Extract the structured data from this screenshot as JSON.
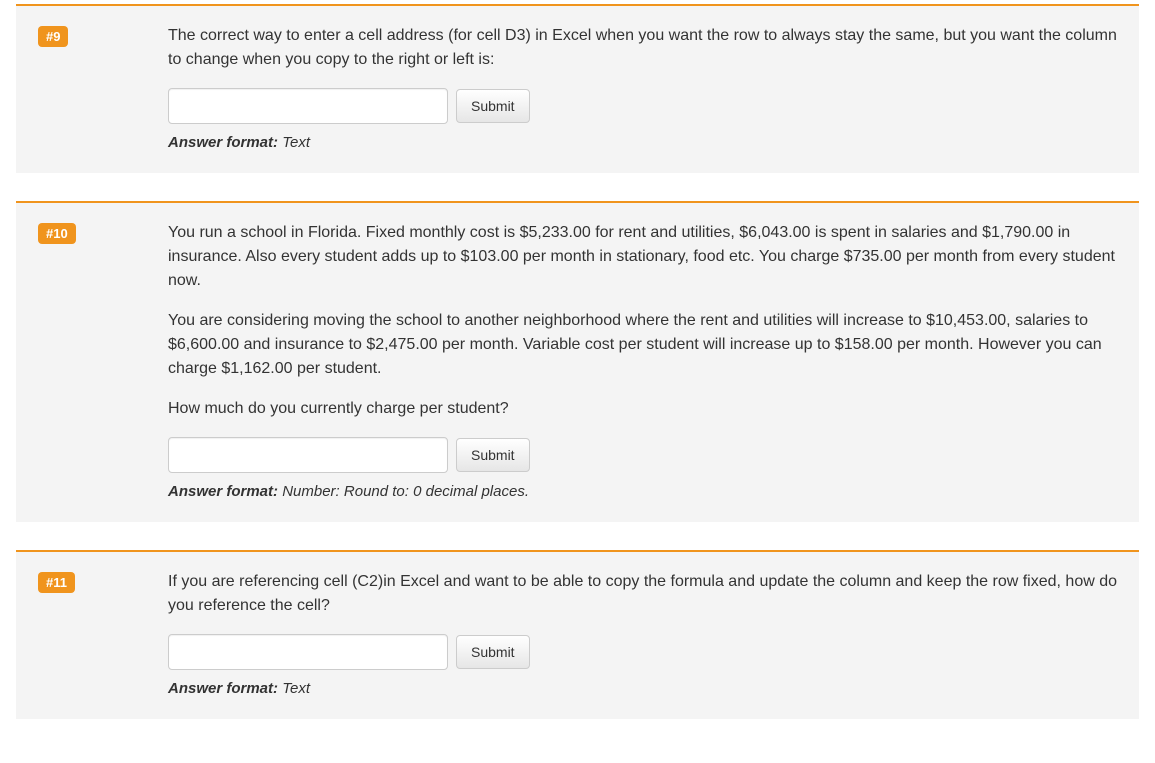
{
  "questions": [
    {
      "badge": "#9",
      "paragraphs": [
        "The correct way to enter a cell address (for cell D3) in Excel when you want the row to always stay the same, but you want the column to change when you copy to the right or left is:"
      ],
      "submit_label": "Submit",
      "format_label": "Answer format:",
      "format_value": "Text"
    },
    {
      "badge": "#10",
      "paragraphs": [
        "You run a school in Florida. Fixed monthly cost is $5,233.00 for rent and utilities, $6,043.00 is spent in salaries and $1,790.00 in insurance. Also every student adds up to $103.00 per month in stationary, food etc. You charge $735.00 per month from every student now.",
        "You are considering moving the school to another neighborhood where the rent and utilities will increase to $10,453.00, salaries to $6,600.00 and insurance to $2,475.00 per month. Variable cost per student will increase up to $158.00 per month. However you can charge $1,162.00 per student.",
        "How much do you currently charge per student?"
      ],
      "submit_label": "Submit",
      "format_label": "Answer format:",
      "format_value": "Number: Round to: 0 decimal places."
    },
    {
      "badge": "#11",
      "paragraphs": [
        "If you are referencing cell (C2)in Excel and want to be able to copy the formula and update the column and keep the row fixed, how do you reference the cell?"
      ],
      "submit_label": "Submit",
      "format_label": "Answer format:",
      "format_value": "Text"
    }
  ]
}
